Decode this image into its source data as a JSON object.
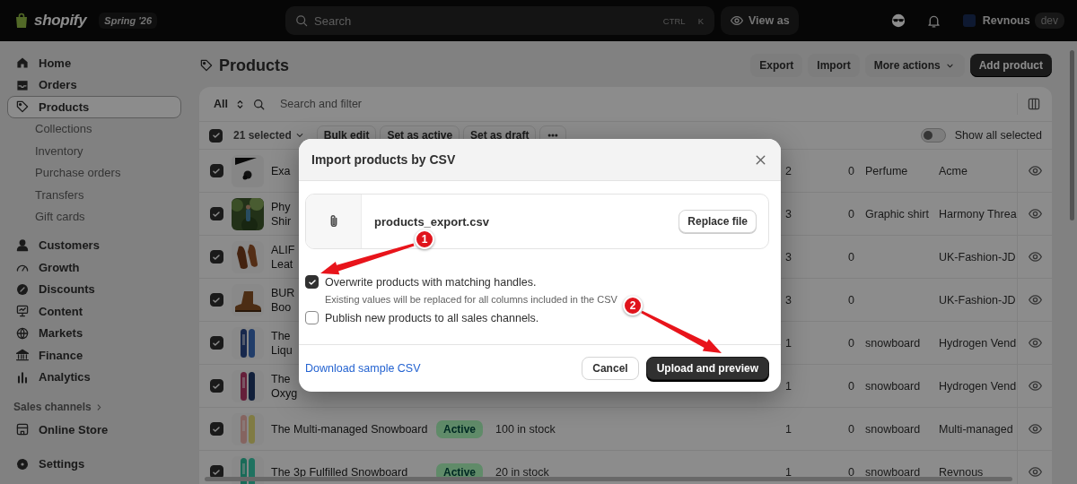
{
  "topbar": {
    "logo": "shopify",
    "edition": "Spring '26",
    "search": {
      "placeholder": "Search",
      "shortcut": [
        "CTRL",
        "K"
      ]
    },
    "view_as": "View as",
    "user": {
      "name": "Revnous",
      "badge": "dev"
    }
  },
  "sidebar": {
    "items": [
      {
        "label": "Home",
        "selected": false
      },
      {
        "label": "Orders",
        "selected": false
      },
      {
        "label": "Products",
        "selected": true,
        "children": [
          {
            "label": "Collections",
            "selected": false
          },
          {
            "label": "Inventory",
            "selected": false
          },
          {
            "label": "Purchase orders",
            "selected": false
          },
          {
            "label": "Transfers",
            "selected": false
          },
          {
            "label": "Gift cards",
            "selected": false
          }
        ]
      },
      {
        "label": "Customers",
        "selected": false
      },
      {
        "label": "Growth",
        "selected": false
      },
      {
        "label": "Discounts",
        "selected": false
      },
      {
        "label": "Content",
        "selected": false
      },
      {
        "label": "Markets",
        "selected": false
      },
      {
        "label": "Finance",
        "selected": false
      },
      {
        "label": "Analytics",
        "selected": false
      }
    ],
    "sales_channels": {
      "label": "Sales channels",
      "items": [
        {
          "label": "Online Store",
          "selected": false
        }
      ]
    },
    "settings": {
      "label": "Settings",
      "selected": false
    }
  },
  "page": {
    "title": "Products",
    "actions": [
      {
        "label": "Export",
        "kind": "secondary"
      },
      {
        "label": "Import",
        "kind": "secondary"
      },
      {
        "label": "More actions",
        "kind": "menu"
      },
      {
        "label": "Add product",
        "kind": "primary"
      }
    ]
  },
  "filters": {
    "view": "All",
    "search": {
      "placeholder": "Search and filter"
    }
  },
  "bulk": {
    "checked": true,
    "count": "21 selected",
    "actions": [
      "Bulk edit",
      "Set as active",
      "Set as draft"
    ],
    "show_all_selected": {
      "label": "Show all selected",
      "on": false
    }
  },
  "rows": [
    {
      "selected": true,
      "name_lines": [
        "Exa"
      ],
      "column_6": "2",
      "column_7": "0",
      "type": "Perfume",
      "vendor": "Acme"
    },
    {
      "selected": true,
      "name_lines": [
        "Phy",
        "Shir"
      ],
      "column_6": "3",
      "column_7": "0",
      "type": "Graphic shirt",
      "vendor": "Harmony Threa"
    },
    {
      "selected": true,
      "name_lines": [
        "ALIF",
        "Leat"
      ],
      "column_6": "3",
      "column_7": "0",
      "vendor": "UK-Fashion-JD"
    },
    {
      "selected": true,
      "name_lines": [
        "BUR",
        "Boo"
      ],
      "column_6": "3",
      "column_7": "0",
      "vendor": "UK-Fashion-JD"
    },
    {
      "selected": true,
      "name_lines": [
        "The",
        "Liqu"
      ],
      "column_6": "1",
      "column_7": "0",
      "type": "snowboard",
      "vendor": "Hydrogen Vend"
    },
    {
      "selected": true,
      "name_lines": [
        "The",
        "Oxyg"
      ],
      "column_6": "1",
      "column_7": "0",
      "type": "snowboard",
      "vendor": "Hydrogen Vend"
    },
    {
      "selected": true,
      "name_lines": [
        "The Multi-managed Snowboard"
      ],
      "status": "Active",
      "inventory": "100 in stock",
      "column_6": "1",
      "column_7": "0",
      "type": "snowboard",
      "vendor": "Multi-managed"
    },
    {
      "selected": true,
      "name_lines": [
        "The 3p Fulfilled Snowboard"
      ],
      "status": "Active",
      "inventory": "20 in stock",
      "column_6": "1",
      "column_7": "0",
      "type": "snowboard",
      "vendor": "Revnous"
    }
  ],
  "modal": {
    "title": "Import products by CSV",
    "file": {
      "name": "products_export.csv",
      "action": "Replace file"
    },
    "options": [
      {
        "label": "Overwrite products with matching handles.",
        "checked": true,
        "hint": "Existing values will be replaced for all columns included in the CSV"
      },
      {
        "label": "Publish new products to all sales channels.",
        "checked": false
      }
    ],
    "link": "Download sample CSV",
    "buttons": [
      {
        "label": "Cancel",
        "kind": "secondary"
      },
      {
        "label": "Upload and preview",
        "kind": "primary"
      }
    ]
  },
  "annotations": [
    {
      "label": "1"
    },
    {
      "label": "2"
    }
  ]
}
